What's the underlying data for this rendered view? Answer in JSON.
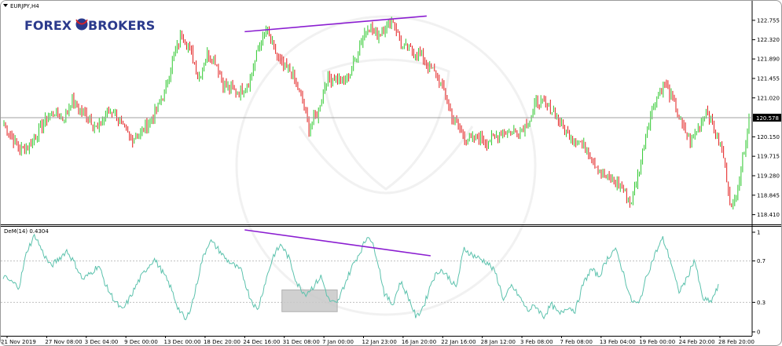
{
  "window": {
    "symbol_label": "EURJPY,H4"
  },
  "logo": {
    "part1": "FOREX",
    "part2": "BROKERS"
  },
  "indicator": {
    "label": "DeM(14) 0.4304"
  },
  "price_axis": [
    "122.755",
    "122.320",
    "121.890",
    "121.455",
    "121.020",
    "120.150",
    "119.715",
    "119.280",
    "118.845",
    "118.410"
  ],
  "current_price": {
    "value": 120.578,
    "label": "120.578"
  },
  "dem_axis": [
    "1",
    "0.7",
    "0.3",
    "0"
  ],
  "time_axis": [
    "21 Nov 2019",
    "27 Nov 08:00",
    "3 Dec 04:00",
    "9 Dec 00:00",
    "13 Dec 00:00",
    "18 Dec 20:00",
    "24 Dec 16:00",
    "31 Dec 08:00",
    "7 Jan 00:00",
    "12 Jan 23:00",
    "16 Jan 20:00",
    "22 Jan 16:00",
    "28 Jan 12:00",
    "3 Feb 08:00",
    "7 Feb 08:00",
    "13 Feb 04:00",
    "19 Feb 00:00",
    "24 Feb 20:00",
    "28 Feb 20:00"
  ],
  "colors": {
    "bull": "#2ec82e",
    "bear": "#e21b1b",
    "dem_line": "#5cc2ad",
    "divergence": "#8b1ed1",
    "box": "#c8c8c8",
    "grid": "#c0c0c0"
  },
  "chart_data": [
    {
      "type": "candlestick",
      "title": "EURJPY,H4",
      "ylim": [
        118.28,
        123.05
      ],
      "price_path": [
        120.45,
        120.1,
        119.85,
        119.95,
        120.25,
        120.55,
        120.7,
        120.55,
        120.95,
        120.75,
        120.6,
        120.3,
        120.65,
        120.75,
        120.35,
        120.1,
        120.2,
        120.45,
        120.75,
        121.15,
        121.9,
        122.45,
        122.1,
        121.45,
        122.0,
        121.85,
        121.3,
        121.2,
        121.15,
        121.4,
        122.1,
        122.55,
        122.05,
        121.7,
        121.6,
        121.1,
        120.35,
        120.65,
        121.4,
        121.5,
        121.35,
        121.6,
        122.2,
        122.65,
        122.4,
        122.6,
        122.75,
        122.15,
        122.1,
        122.0,
        121.75,
        121.55,
        121.15,
        120.55,
        120.25,
        120.05,
        120.15,
        120.05,
        120.15,
        120.3,
        120.25,
        120.3,
        120.5,
        120.95,
        120.85,
        120.7,
        120.35,
        120.15,
        120.05,
        119.8,
        119.5,
        119.25,
        119.15,
        119.05,
        118.65,
        119.35,
        120.4,
        121.0,
        121.35,
        120.95,
        120.45,
        120.05,
        120.35,
        120.75,
        120.25,
        119.7,
        118.45,
        119.35,
        120.55
      ],
      "divergence_line": {
        "from": {
          "date": "24 Dec 16:00",
          "price": 122.5
        },
        "to": {
          "date": "16 Jan 20:00",
          "price": 122.85
        }
      },
      "current_price": 120.578
    },
    {
      "type": "line",
      "title": "DeM(14) 0.4304",
      "ylim": [
        0,
        1
      ],
      "levels": [
        0.7,
        0.3
      ],
      "series": [
        {
          "name": "DeM(14)",
          "values": [
            0.55,
            0.5,
            0.45,
            0.8,
            0.95,
            0.78,
            0.65,
            0.72,
            0.8,
            0.68,
            0.52,
            0.58,
            0.66,
            0.45,
            0.32,
            0.22,
            0.35,
            0.5,
            0.62,
            0.72,
            0.6,
            0.46,
            0.25,
            0.12,
            0.35,
            0.7,
            0.9,
            0.82,
            0.72,
            0.66,
            0.6,
            0.36,
            0.22,
            0.5,
            0.75,
            0.86,
            0.72,
            0.48,
            0.38,
            0.45,
            0.55,
            0.32,
            0.28,
            0.48,
            0.66,
            0.8,
            0.96,
            0.75,
            0.38,
            0.28,
            0.5,
            0.35,
            0.15,
            0.28,
            0.52,
            0.62,
            0.55,
            0.44,
            0.82,
            0.76,
            0.72,
            0.68,
            0.58,
            0.32,
            0.46,
            0.35,
            0.22,
            0.27,
            0.16,
            0.28,
            0.18,
            0.26,
            0.22,
            0.48,
            0.62,
            0.55,
            0.72,
            0.82,
            0.6,
            0.32,
            0.28,
            0.56,
            0.76,
            0.92,
            0.7,
            0.4,
            0.52,
            0.72,
            0.34,
            0.3,
            0.45
          ]
        }
      ],
      "divergence_line": {
        "from": {
          "date": "24 Dec 16:00",
          "value": 1.0
        },
        "to": {
          "date": "16 Jan 20:00",
          "value": 0.75
        }
      },
      "highlight_box": {
        "from_date": "31 Dec 08:00",
        "to_date": "7 Jan 00:00",
        "value_range": [
          0.21,
          0.42
        ]
      }
    }
  ]
}
